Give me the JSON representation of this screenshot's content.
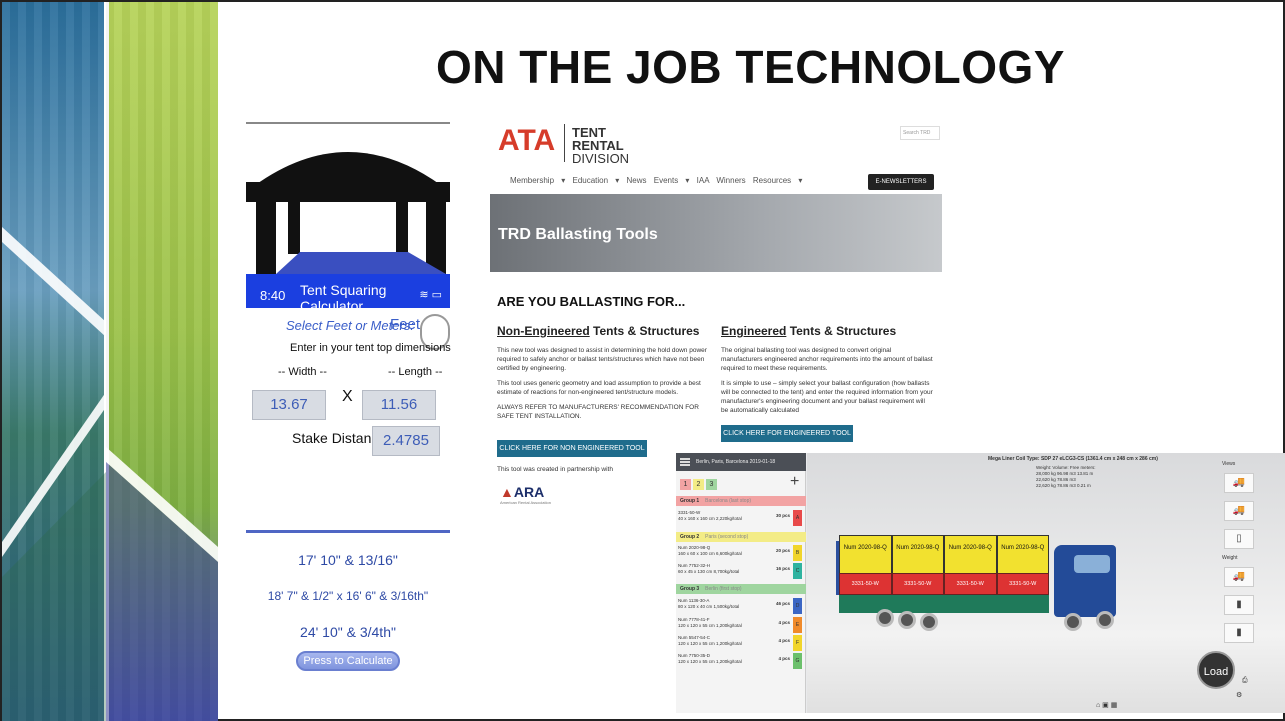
{
  "slide": {
    "title": "ON THE JOB TECHNOLOGY"
  },
  "calculator": {
    "time": "8:40",
    "app_title": "Tent Squaring Calculator",
    "unit_prompt": "Select Feet or Meters:",
    "unit_value": "Feet",
    "instruction": "Enter in your tent top dimensions",
    "width_label": "-- Width --",
    "length_label": "-- Length --",
    "times": "X",
    "width_value": "13.67",
    "length_value": "11.56",
    "stake_label": "Stake Distance:",
    "stake_value": "2.4785",
    "results": [
      "17' 10\" & 13/16\"",
      "18' 7\" & 1/2\" x 16' 6\" & 3/16th\"",
      "24' 10\" & 3/4th\""
    ],
    "calculate_button": "Press to Calculate"
  },
  "website": {
    "logo": "ATA",
    "division": [
      "TENT",
      "RENTAL",
      "DIVISION"
    ],
    "search_placeholder": "Search TRD",
    "nav": "Membership ▾   Education ▾   News   Events ▾   IAA Winners   Resources ▾",
    "enewsletters": "E-NEWSLETTERS",
    "hero_title": "TRD Ballasting Tools",
    "question": "ARE YOU BALLASTING FOR...",
    "non_engineered": {
      "heading_u": "Non-Engineered",
      "heading_rest": " Tents & Structures",
      "paragraphs": [
        "This new tool was designed to assist in determining the hold down power required to safely anchor or ballast tents/structures which have not been certified by engineering.",
        "This tool uses generic geometry and load assumption to provide a best estimate of reactions for non-engineered tent/structure models.",
        "ALWAYS REFER TO MANUFACTURERS' RECOMMENDATION FOR SAFE TENT INSTALLATION."
      ],
      "button": "CLICK HERE FOR NON ENGINEERED TOOL"
    },
    "engineered": {
      "heading_u": "Engineered",
      "heading_rest": " Tents & Structures",
      "paragraphs": [
        "The original ballasting tool was designed to convert original manufacturers engineered anchor requirements into the amount of ballast required to meet these requirements.",
        "It is simple to use – simply select your ballast configuration (how ballasts will be connected to the tent) and enter the required information from your manufacturer's engineering document and your ballast requirement will be automatically calculated"
      ],
      "button": "CLICK HERE FOR ENGINEERED TOOL"
    },
    "partner_text": "This tool was created in partnership with",
    "partner_logo": "ARA",
    "partner_sub": "American Rental Association"
  },
  "load_planner": {
    "header": "Berlin, Paris, Barcelona 2019-01-18",
    "tabs": [
      "1",
      "2",
      "3"
    ],
    "groups": [
      {
        "label": "Group 1",
        "stop": "Barcelona (last stop)",
        "color": "#f2a3a3"
      },
      {
        "label": "Group 2",
        "stop": "Paris (second stop)",
        "color": "#f3ec86"
      },
      {
        "label": "Group 3",
        "stop": "Berlin (first stop)",
        "color": "#9fd59f"
      }
    ],
    "items": [
      {
        "name": "3331-50-W",
        "dims": "40 x 160 x 160 cm 2,220kg/total",
        "pcs": "30 pcs",
        "tag": "A",
        "color": "#e84a4a"
      },
      {
        "name": "Num 2020-98-Q",
        "dims": "160 x 60 x 100 cm 6,600kg/total",
        "pcs": "20 pcs",
        "tag": "B",
        "color": "#f1d52b"
      },
      {
        "name": "Num 7752-32-H",
        "dims": "60 x 45 x 130 cm 8,700kg/total",
        "pcs": "16 pcs",
        "tag": "C",
        "color": "#2fb3a0"
      },
      {
        "name": "Num 1136-30-A",
        "dims": "80 x 120 x 40 cm 1,500kg/total",
        "pcs": "46 pcs",
        "tag": "D",
        "color": "#3b66c4"
      },
      {
        "name": "Num 7778-41-F",
        "dims": "120 x 120 x 55 cm 1,200kg/total",
        "pcs": "4 pcs",
        "tag": "E",
        "color": "#f08a2a"
      },
      {
        "name": "Num 5547-54-C",
        "dims": "120 x 120 x 55 cm 1,200kg/total",
        "pcs": "4 pcs",
        "tag": "F",
        "color": "#f1d52b"
      },
      {
        "name": "Num 7750-35-D",
        "dims": "120 x 120 x 55 cm 1,200kg/total",
        "pcs": "4 pcs",
        "tag": "G",
        "color": "#6cc06c"
      }
    ],
    "coil_title": "Mega Liner Coil Type: SDP 27 eLCG3-CS (1361.4 cm x 248 cm x 286 cm)",
    "stats": [
      "Weight:    Volume:   Free meters:",
      "28,000 kg   96.98 m3   13.81 m",
      "22,620 kg   78.86 m3",
      "22,620 kg   78.86 m3   0.21 m"
    ],
    "views_label": "Views",
    "weight_label": "Weight",
    "cargo_top": [
      "Num 2020-98-Q",
      "Num 2020-98-Q",
      "Num 2020-98-Q",
      "Num 2020-98-Q"
    ],
    "cargo_mid": [
      "3331-50-W",
      "3331-50-W",
      "3331-50-W",
      "3331-50-W"
    ],
    "load_button": "Load"
  }
}
